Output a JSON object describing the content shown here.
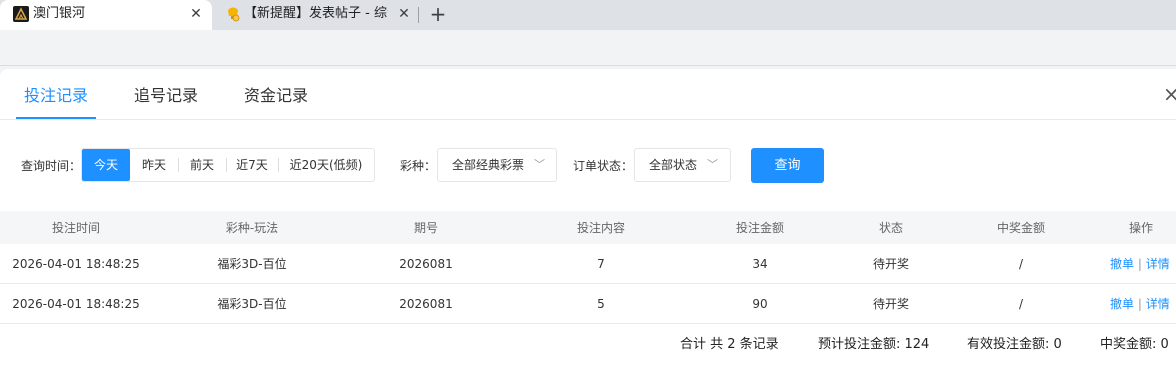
{
  "browser": {
    "tabs": [
      {
        "title": "澳门银河",
        "active": true
      },
      {
        "title": "【新提醒】发表帖子 - 综合交流",
        "active": false
      }
    ],
    "close_glyph": "✕",
    "new_tab_glyph": "+"
  },
  "panel": {
    "tabs": [
      "投注记录",
      "追号记录",
      "资金记录"
    ],
    "close_glyph": "×",
    "accent": "#1e90ff"
  },
  "filters": {
    "time_label": "查询时间：",
    "time_options": [
      "今天",
      "昨天",
      "前天",
      "近7天",
      "近20天(低频)"
    ],
    "selected_time": "今天",
    "lottery_label": "彩种：",
    "lottery_value": "全部经典彩票",
    "status_label": "订单状态：",
    "status_value": "全部状态",
    "query_button": "查询"
  },
  "table": {
    "columns": [
      "投注时间",
      "彩种-玩法",
      "期号",
      "投注内容",
      "投注金额",
      "状态",
      "中奖金额",
      "操作"
    ],
    "rows": [
      {
        "time": "2026-04-01 18:48:25",
        "game": "福彩3D-百位",
        "issue": "2026081",
        "content": "7",
        "amount": "34",
        "status": "待开奖",
        "prize": "/",
        "cancel": "撤单",
        "sep": "|",
        "detail": "详情"
      },
      {
        "time": "2026-04-01 18:48:25",
        "game": "福彩3D-百位",
        "issue": "2026081",
        "content": "5",
        "amount": "90",
        "status": "待开奖",
        "prize": "/",
        "cancel": "撤单",
        "sep": "|",
        "detail": "详情"
      }
    ]
  },
  "summary": {
    "total": "合计 共 2 条记录",
    "expected_bet": "预计投注金额: 124",
    "valid_bet": "有效投注金额: 0",
    "prize": "中奖金额: 0"
  }
}
